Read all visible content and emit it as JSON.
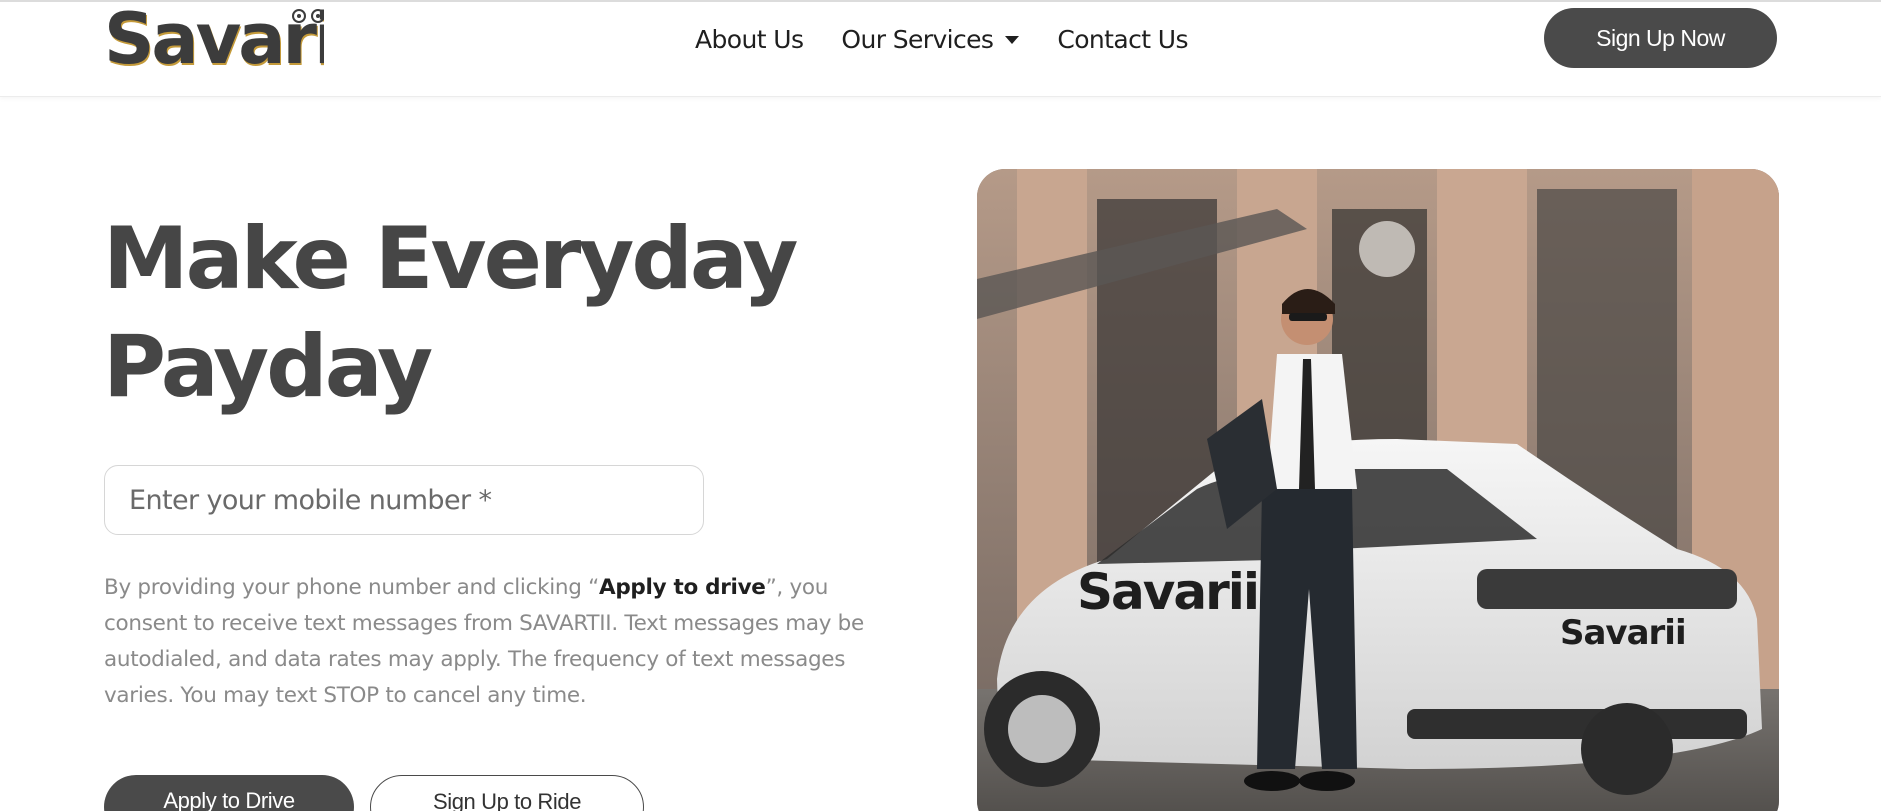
{
  "brand": {
    "name": "Savarii"
  },
  "nav": {
    "links": [
      {
        "label": "About Us"
      },
      {
        "label": "Our Services"
      },
      {
        "label": "Contact Us"
      }
    ],
    "cta": "Sign Up Now"
  },
  "hero": {
    "headline_line1": "Make Everyday",
    "headline_line2": "Payday",
    "mobile_placeholder": "Enter your mobile number *",
    "consent_pre": "By providing your phone number and clicking “",
    "consent_bold": "Apply to drive",
    "consent_post": "”, you consent to receive text messages from SAVARTII. Text messages may be autodialed, and data rates may apply. The frequency of text messages varies. You may text STOP to cancel any time.",
    "apply_button": "Apply to Drive",
    "ride_button": "Sign Up to Ride",
    "image_car_text": "Savarii"
  },
  "colors": {
    "primary": "#4a4a4a",
    "logo_accent": "#c49a3a",
    "text_dark": "#1f1f1f",
    "text_muted": "#8a8a8a"
  }
}
